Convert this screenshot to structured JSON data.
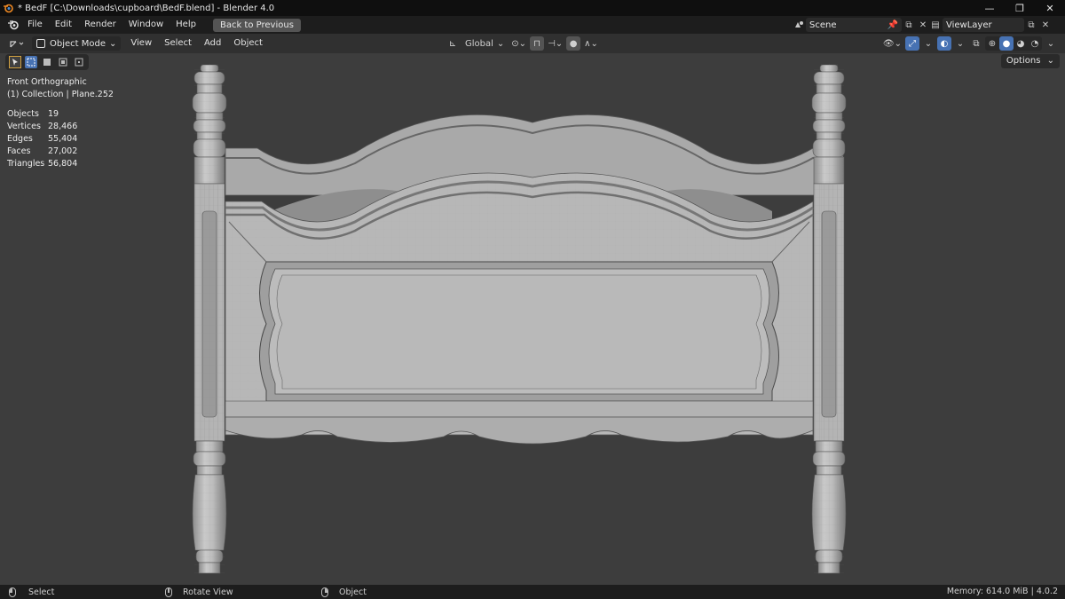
{
  "window": {
    "title": "* BedF [C:\\Downloads\\cupboard\\BedF.blend] - Blender 4.0",
    "minimize": "—",
    "maximize": "❐",
    "close": "✕"
  },
  "topbar": {
    "menus": [
      "File",
      "Edit",
      "Render",
      "Window",
      "Help"
    ],
    "back_button": "Back to Previous",
    "scene": "Scene",
    "view_layer": "ViewLayer"
  },
  "header": {
    "mode": "Object Mode",
    "menus": [
      "View",
      "Select",
      "Add",
      "Object"
    ],
    "transform_orientation": "Global"
  },
  "viewport": {
    "options_label": "Options",
    "view_name": "Front Orthographic",
    "collection_info": "(1) Collection | Plane.252",
    "stats": [
      {
        "label": "Objects",
        "value": "19"
      },
      {
        "label": "Vertices",
        "value": "28,466"
      },
      {
        "label": "Edges",
        "value": "55,404"
      },
      {
        "label": "Faces",
        "value": "27,002"
      },
      {
        "label": "Triangles",
        "value": "56,804"
      }
    ]
  },
  "statusbar": {
    "left_click": "Select",
    "middle_click": "Rotate View",
    "right_click": "Object",
    "memory": "Memory: 614.0 MiB | 4.0.2"
  },
  "colors": {
    "viewport_bg": "#3d3d3d",
    "accent": "#4772b3",
    "model": "#b9b9b9"
  }
}
